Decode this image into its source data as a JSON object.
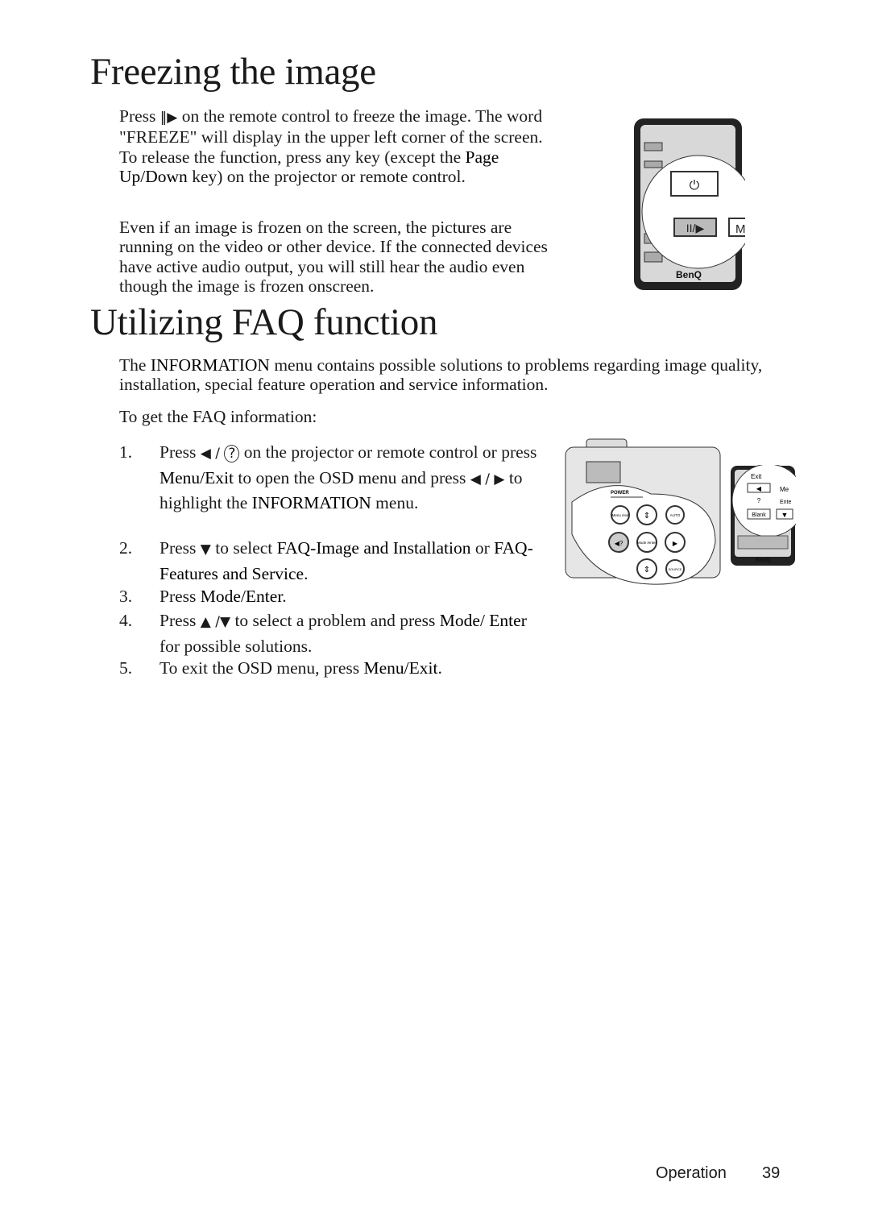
{
  "section1": {
    "title": "Freezing the image",
    "para1": {
      "pre": "Press ",
      "icon": "pause-play-icon",
      "post": " on the remote control to freeze the image. The word \"FREEZE\" will display in the upper left corner of the screen. To release the function, press any key (except the ",
      "key": "Page Up/Down",
      "end": " key) on the projector or remote control."
    },
    "para2": "Even if an image is frozen on the screen, the pictures are running on the video or other device. If the connected devices have active audio output, you will still hear the audio even though the image is frozen onscreen.",
    "remote_labels": {
      "brand": "BenQ",
      "freeze_button": "II/▶",
      "menu_partial": "Me"
    }
  },
  "section2": {
    "title": "Utilizing FAQ function",
    "intro": {
      "pre": "The ",
      "key": "INFORMATION",
      "post": " menu contains possible solutions to problems regarding image quality, installation, special feature operation and service information."
    },
    "lead": "To get the FAQ information:",
    "steps": [
      {
        "num": "1.",
        "parts": [
          "Press ",
          "◀ / ",
          "?",
          " on the projector or remote control or press ",
          "Menu/Exit",
          " to open the OSD menu and press ",
          "◀ / ▶",
          " to highlight the ",
          "INFORMATION",
          " menu."
        ]
      },
      {
        "num": "2.",
        "parts": [
          "Press ",
          "▼",
          " to select ",
          "FAQ-Image and Installation",
          " or ",
          "FAQ-Features and Service",
          "."
        ]
      },
      {
        "num": "3.",
        "parts": [
          "Press ",
          "Mode/Enter",
          "."
        ]
      },
      {
        "num": "4.",
        "parts": [
          "Press ",
          "▲ /▼",
          " to select a problem and press ",
          "Mode/ Enter",
          " for possible solutions."
        ]
      },
      {
        "num": "5.",
        "parts": [
          "To exit the OSD menu, press ",
          "Menu/Exit",
          "."
        ]
      }
    ],
    "projector_labels": {
      "power": "POWER",
      "menu": "Menu /exit",
      "auto": "AUTO",
      "mode": "Mode /enter",
      "source": "SOURCE"
    },
    "remote_labels": {
      "exit": "Exit",
      "enter_partial": "Ente",
      "blank": "Blank",
      "menu_partial": "Me",
      "brand": "BenQ"
    }
  },
  "footer": {
    "section": "Operation",
    "page": "39"
  }
}
